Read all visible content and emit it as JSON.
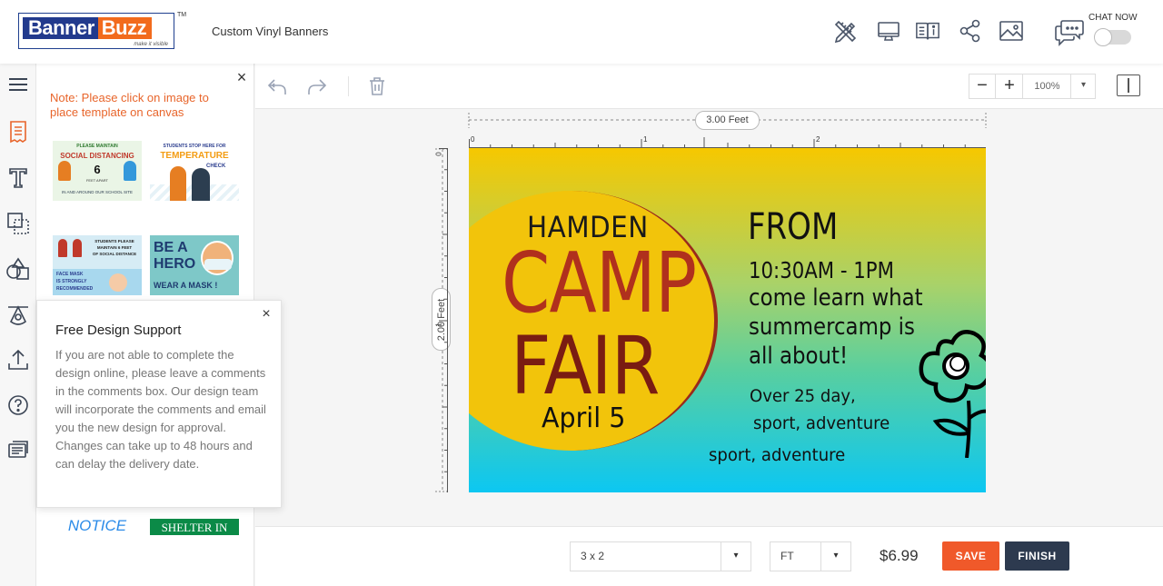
{
  "header": {
    "logo_banner": "Banner",
    "logo_buzz": "Buzz",
    "logo_tagline": "make it visible",
    "logo_tm": "TM",
    "product_title": "Custom Vinyl Banners",
    "chat_now": "CHAT NOW",
    "icons": [
      "design-tools-icon",
      "desktop-preview-icon",
      "product-info-icon",
      "share-icon",
      "image-icon",
      "chat-icon"
    ]
  },
  "rail": {
    "icons": [
      "menu-icon",
      "templates-icon",
      "text-icon",
      "layers-icon",
      "shapes-icon",
      "clipart-icon",
      "upload-icon",
      "help-icon",
      "comments-icon"
    ],
    "active": "templates-icon"
  },
  "panel": {
    "close": "×",
    "note": "Note: Please click on image to place template on canvas",
    "thumbs": {
      "t1_line1": "PLEASE MAINTAIN",
      "t1_line2": "SOCIAL DISTANCING",
      "t1_number": "6",
      "t1_line3": "FEET APART",
      "t1_line4": "IN AND AROUND OUR SCHOOL SITE",
      "t2_line1": "STUDENTS STOP HERE FOR",
      "t2_line2": "TEMPERATURE",
      "t2_line3": "CHECK",
      "t3_line1": "STUDENTS PLEASE",
      "t3_line2": "MAINTAIN 6 FEET",
      "t3_line3": "OF SOCIAL DISTANCE",
      "t3_line4": "FACE MASK",
      "t3_line5": "IS STRONGLY",
      "t3_line6": "RECOMMENDED",
      "t4_line1": "BE A",
      "t4_line2": "HERO",
      "t4_line3": "WEAR A MASK !",
      "t5_text": "NOTICE",
      "t6_text": "SHELTER IN PLACE"
    }
  },
  "popup": {
    "title": "Free Design Support",
    "close": "×",
    "body": "If you are not able to complete the design online, please leave a comments in the comments box. Our design team will incorporate the comments and email you the new design for approval. Changes can take up to 48 hours and can delay the delivery date."
  },
  "toolbar": {
    "icons": [
      "undo-icon",
      "redo-icon",
      "trash-icon"
    ],
    "zoom_minus": "−",
    "zoom_plus": "+",
    "zoom_value": "100%",
    "zoom_caret": "▾"
  },
  "canvas": {
    "width_label": "3.00 Feet",
    "height_label": "2.00 Feet",
    "ruler_h_ticks": [
      "0",
      "1",
      "2"
    ],
    "ruler_v_ticks": [
      "0",
      "1"
    ]
  },
  "banner": {
    "hamden": "HAMDEN",
    "camp": "CAMP",
    "fair": "FAIR",
    "date": "April 5",
    "from": "FROM",
    "time": "10:30AM - 1PM",
    "line1": "come learn what",
    "line2": "summercamp is",
    "line3": "all about!",
    "line4": "Over 25 day,",
    "line5": "sport, adventure",
    "line6": "sport, adventure",
    "colors": {
      "top": "#f6c800",
      "bottom": "#0cc7f2",
      "circle": "#f2c40b",
      "camp": "#b0301d"
    }
  },
  "bottom": {
    "size_value": "3 x 2",
    "unit_value": "FT",
    "price": "$6.99",
    "save_label": "SAVE",
    "finish_label": "FINISH",
    "caret": "▾"
  }
}
